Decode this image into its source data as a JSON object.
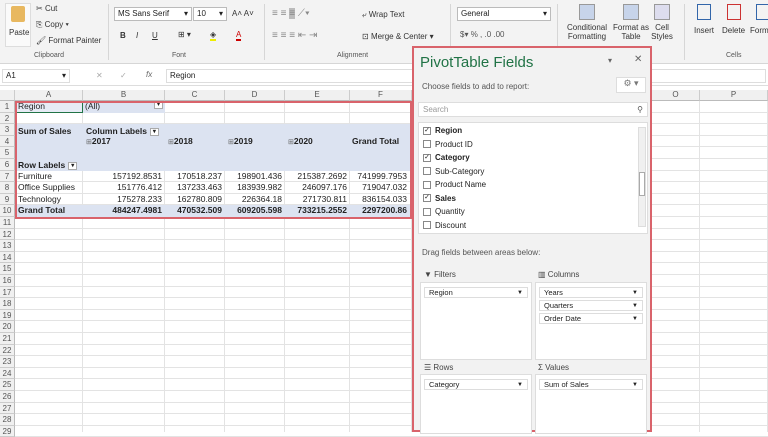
{
  "ribbon": {
    "paste": "Paste",
    "cut": "Cut",
    "copy": "Copy",
    "format_painter": "Format Painter",
    "clipboard": "Clipboard",
    "font_name": "MS Sans Serif",
    "font_size": "10",
    "font": "Font",
    "wrap_text": "Wrap Text",
    "merge_center": "Merge & Center",
    "alignment": "Alignment",
    "number_format": "General",
    "conditional_formatting": "Conditional Formatting",
    "format_as_table": "Format as Table",
    "cell_styles": "Cell Styles",
    "insert": "Insert",
    "delete": "Delete",
    "format": "Format",
    "cells": "Cells",
    "bold": "B",
    "italic": "I",
    "underline": "U"
  },
  "formula_bar": {
    "name_box": "A1",
    "fx": "fx",
    "value": "Region"
  },
  "columns": [
    "A",
    "B",
    "C",
    "D",
    "E",
    "F",
    "O",
    "P"
  ],
  "rows": [
    "1",
    "2",
    "3",
    "4",
    "5",
    "6",
    "7",
    "8",
    "9",
    "10",
    "11",
    "12",
    "13",
    "14",
    "15",
    "16",
    "17",
    "18",
    "19",
    "20",
    "21",
    "22",
    "23",
    "24",
    "25",
    "26",
    "27",
    "28",
    "29"
  ],
  "pivot": {
    "filter_label": "Region",
    "filter_value": "(All)",
    "sum_label": "Sum of Sales",
    "column_labels": "Column Labels",
    "row_labels": "Row Labels",
    "years": [
      "2017",
      "2018",
      "2019",
      "2020"
    ],
    "grand_total_col": "Grand Total",
    "data": [
      {
        "label": "Furniture",
        "values": [
          "157192.8531",
          "170518.237",
          "198901.436",
          "215387.2692",
          "741999.7953"
        ]
      },
      {
        "label": "Office Supplies",
        "values": [
          "151776.412",
          "137233.463",
          "183939.982",
          "246097.176",
          "719047.032"
        ]
      },
      {
        "label": "Technology",
        "values": [
          "175278.233",
          "162780.809",
          "226364.18",
          "271730.811",
          "836154.033"
        ]
      }
    ],
    "grand_total": {
      "label": "Grand Total",
      "values": [
        "484247.4981",
        "470532.509",
        "609205.598",
        "733215.2552",
        "2297200.86"
      ]
    }
  },
  "panel": {
    "title": "PivotTable Fields",
    "choose": "Choose fields to add to report:",
    "search_placeholder": "Search",
    "fields": [
      {
        "name": "Region",
        "checked": true
      },
      {
        "name": "Product ID",
        "checked": false
      },
      {
        "name": "Category",
        "checked": true
      },
      {
        "name": "Sub-Category",
        "checked": false
      },
      {
        "name": "Product Name",
        "checked": false
      },
      {
        "name": "Sales",
        "checked": true
      },
      {
        "name": "Quantity",
        "checked": false
      },
      {
        "name": "Discount",
        "checked": false
      }
    ],
    "drag_text": "Drag fields between areas below:",
    "filters": "Filters",
    "columns": "Columns",
    "rows": "Rows",
    "values": "Values",
    "filters_items": [
      "Region"
    ],
    "columns_items": [
      "Years",
      "Quarters",
      "Order Date"
    ],
    "rows_items": [
      "Category"
    ],
    "values_items": [
      "Sum of Sales"
    ]
  },
  "colors": {
    "accent": "#217346",
    "highlight": "#d9636b",
    "band": "#dce3f1"
  }
}
